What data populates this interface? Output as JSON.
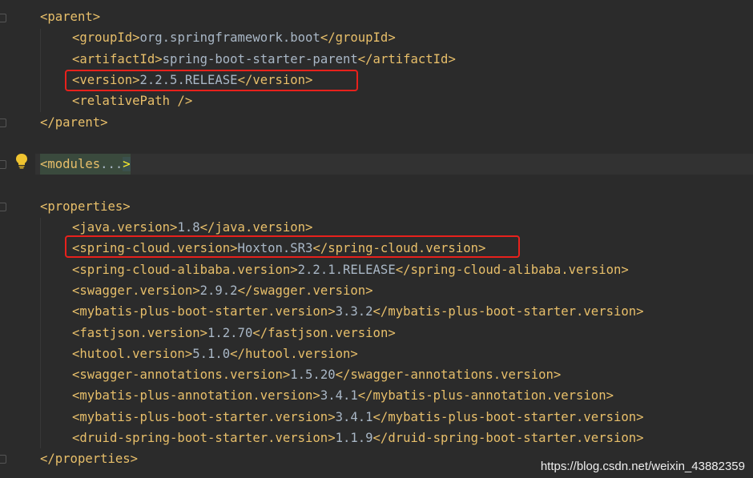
{
  "lines": [
    {
      "segments": [
        {
          "c": "tag",
          "t": "<parent>"
        }
      ]
    },
    {
      "segments": [
        {
          "c": "tag",
          "t": "<groupId>"
        },
        {
          "c": "txt",
          "t": "org.springframework.boot"
        },
        {
          "c": "tag",
          "t": "</groupId>"
        }
      ]
    },
    {
      "segments": [
        {
          "c": "tag",
          "t": "<artifactId>"
        },
        {
          "c": "txt",
          "t": "spring-boot-starter-parent"
        },
        {
          "c": "tag",
          "t": "</artifactId>"
        }
      ]
    },
    {
      "segments": [
        {
          "c": "tag",
          "t": "<version>"
        },
        {
          "c": "txt",
          "t": "2.2.5.RELEASE"
        },
        {
          "c": "tag",
          "t": "</version>"
        }
      ]
    },
    {
      "segments": [
        {
          "c": "tag",
          "t": "<relativePath />"
        }
      ]
    },
    {
      "segments": [
        {
          "c": "tag",
          "t": "</parent>"
        }
      ]
    },
    {
      "segments": []
    },
    {
      "segments": [
        {
          "c": "tag",
          "t": "<modules"
        },
        {
          "c": "dots",
          "t": "..."
        },
        {
          "c": "bracket",
          "t": ">"
        }
      ],
      "folded": true
    },
    {
      "segments": []
    },
    {
      "segments": [
        {
          "c": "tag",
          "t": "<properties>"
        }
      ]
    },
    {
      "segments": [
        {
          "c": "tag",
          "t": "<java.version>"
        },
        {
          "c": "txt",
          "t": "1.8"
        },
        {
          "c": "tag",
          "t": "</java.version>"
        }
      ]
    },
    {
      "segments": [
        {
          "c": "tag",
          "t": "<spring-cloud.version>"
        },
        {
          "c": "txt",
          "t": "Hoxton.SR3"
        },
        {
          "c": "tag",
          "t": "</spring-cloud.version>"
        }
      ]
    },
    {
      "segments": [
        {
          "c": "tag",
          "t": "<spring-cloud-alibaba.version>"
        },
        {
          "c": "txt",
          "t": "2.2.1.RELEASE"
        },
        {
          "c": "tag",
          "t": "</spring-cloud-alibaba.version>"
        }
      ]
    },
    {
      "segments": [
        {
          "c": "tag",
          "t": "<swagger.version>"
        },
        {
          "c": "txt",
          "t": "2.9.2"
        },
        {
          "c": "tag",
          "t": "</swagger.version>"
        }
      ]
    },
    {
      "segments": [
        {
          "c": "tag",
          "t": "<mybatis-plus-boot-starter.version>"
        },
        {
          "c": "txt",
          "t": "3.3.2"
        },
        {
          "c": "tag",
          "t": "</mybatis-plus-boot-starter.version>"
        }
      ]
    },
    {
      "segments": [
        {
          "c": "tag",
          "t": "<fastjson.version>"
        },
        {
          "c": "txt",
          "t": "1.2.70"
        },
        {
          "c": "tag",
          "t": "</fastjson.version>"
        }
      ]
    },
    {
      "segments": [
        {
          "c": "tag",
          "t": "<hutool.version>"
        },
        {
          "c": "txt",
          "t": "5.1.0"
        },
        {
          "c": "tag",
          "t": "</hutool.version>"
        }
      ]
    },
    {
      "segments": [
        {
          "c": "tag",
          "t": "<swagger-annotations.version>"
        },
        {
          "c": "txt",
          "t": "1.5.20"
        },
        {
          "c": "tag",
          "t": "</swagger-annotations.version>"
        }
      ]
    },
    {
      "segments": [
        {
          "c": "tag",
          "t": "<mybatis-plus-annotation.version>"
        },
        {
          "c": "txt",
          "t": "3.4.1"
        },
        {
          "c": "tag",
          "t": "</mybatis-plus-annotation.version>"
        }
      ]
    },
    {
      "segments": [
        {
          "c": "tag",
          "t": "<mybatis-plus-boot-starter.version>"
        },
        {
          "c": "txt",
          "t": "3.4.1"
        },
        {
          "c": "tag",
          "t": "</mybatis-plus-boot-starter.version>"
        }
      ]
    },
    {
      "segments": [
        {
          "c": "tag",
          "t": "<druid-spring-boot-starter.version>"
        },
        {
          "c": "txt",
          "t": "1.1.9"
        },
        {
          "c": "tag",
          "t": "</druid-spring-boot-starter.version>"
        }
      ]
    },
    {
      "segments": [
        {
          "c": "tag",
          "t": "</properties>"
        }
      ]
    }
  ],
  "indents": [
    0,
    1,
    1,
    1,
    1,
    0,
    0,
    0,
    0,
    0,
    1,
    1,
    1,
    1,
    1,
    1,
    1,
    1,
    1,
    1,
    1,
    0
  ],
  "highlights": {
    "version_line": 3,
    "spring_cloud_line": 11
  },
  "watermark": "https://blog.csdn.net/weixin_43882359",
  "colors": {
    "background": "#2b2b2b",
    "tag": "#e8bf6a",
    "text": "#a9b7c6",
    "highlight_box": "#e8211c",
    "bulb": "#f0c430"
  },
  "icons": {
    "gutter": "lightbulb-icon"
  }
}
